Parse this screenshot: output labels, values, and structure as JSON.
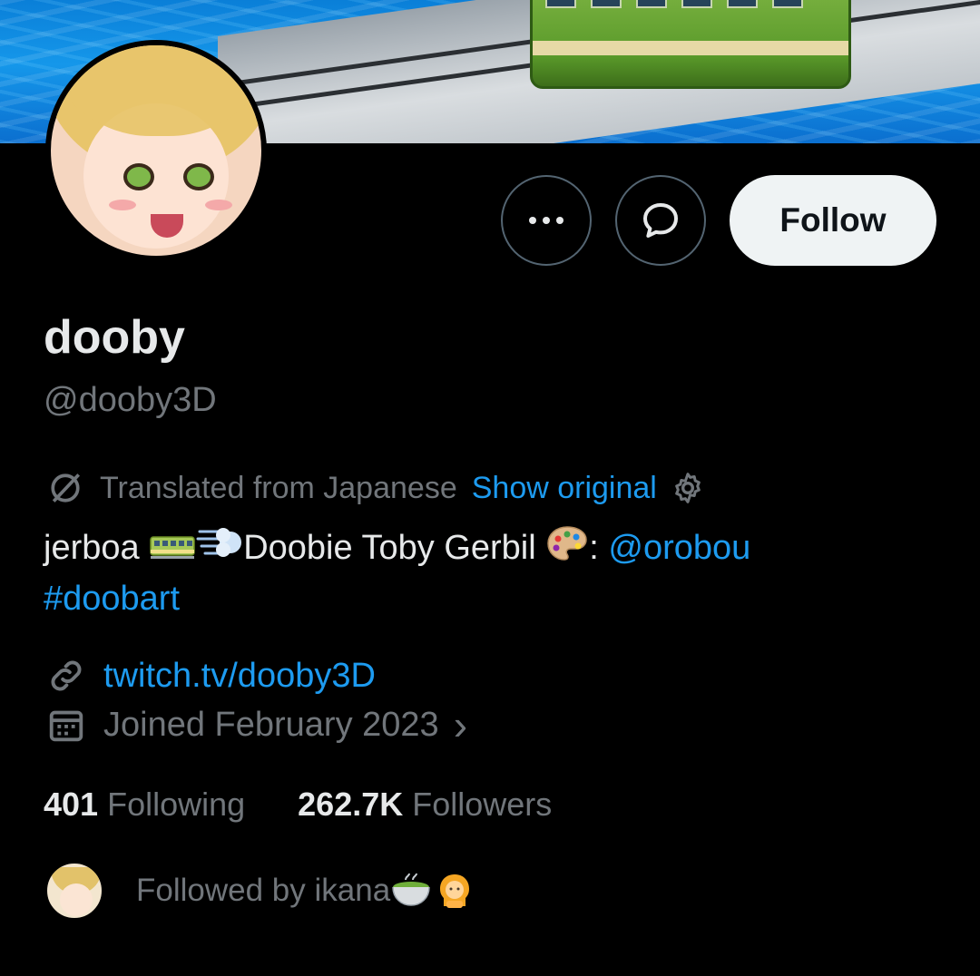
{
  "profile": {
    "name": "dooby",
    "handle": "@dooby3D"
  },
  "actions": {
    "follow_label": "Follow",
    "more_icon": "more-dots-icon",
    "message_icon": "message-bubble-icon"
  },
  "translation": {
    "label": "Translated from Japanese",
    "show_original": "Show original",
    "icon": "translate-icon",
    "settings_icon": "gear-icon"
  },
  "bio": {
    "part1": "jerboa ",
    "part2": "Doobie Toby Gerbil ",
    "part3": ": ",
    "mention": "@orobou",
    "hashtag": "#doobart"
  },
  "meta": {
    "url": "twitch.tv/dooby3D",
    "joined": "Joined February 2023",
    "joined_chevron": "›"
  },
  "stats": {
    "following_count": "401",
    "following_label": "Following",
    "followers_count": "262.7K",
    "followers_label": "Followers"
  },
  "followed_by": {
    "text": "Followed by ikana "
  },
  "colors": {
    "background": "#000000",
    "accent": "#1d9bf0",
    "muted": "#71767b",
    "text": "#e7e9ea"
  }
}
